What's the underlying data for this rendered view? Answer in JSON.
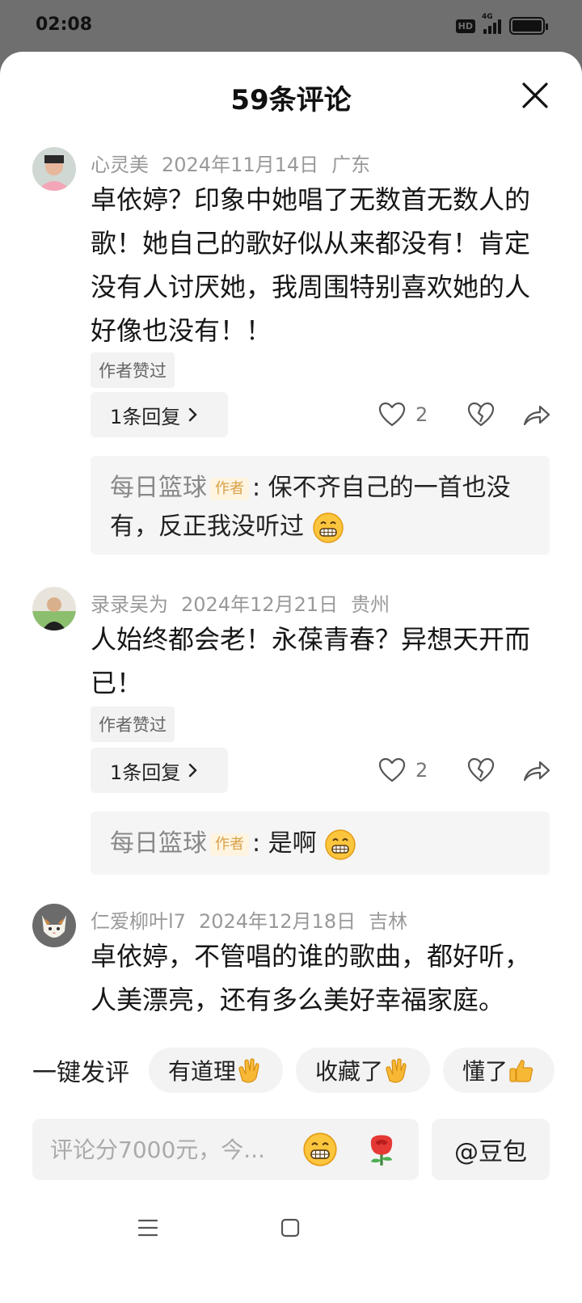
{
  "status": {
    "time": "02:08",
    "hd": "HD",
    "network": "4G"
  },
  "sheet": {
    "title": "59条评论"
  },
  "comments": [
    {
      "author": "心灵美",
      "date": "2024年11月14日",
      "location": "广东",
      "text": "卓依婷？印象中她唱了无数首无数人的歌！她自己的歌好似从来都没有！肯定没有人讨厌她，我周围特别喜欢她的人好像也没有！！",
      "liked_badge": "作者赞过",
      "reply_count_label": "1条回复",
      "like_count": "2",
      "reply": {
        "author": "每日篮球",
        "tag": "作者",
        "text": ": 保不齐自己的一首也没有，反正我没听过"
      }
    },
    {
      "author": "录录吴为",
      "date": "2024年12月21日",
      "location": "贵州",
      "text": "人始终都会老！永葆青春？异想天开而已！",
      "liked_badge": "作者赞过",
      "reply_count_label": "1条回复",
      "like_count": "2",
      "reply": {
        "author": "每日篮球",
        "tag": "作者",
        "text": ": 是啊"
      }
    },
    {
      "author": "仁爱柳叶l7",
      "date": "2024年12月18日",
      "location": "吉林",
      "text": "卓依婷，不管唱的谁的歌曲，都好听，人美漂亮，还有多么美好幸福家庭。"
    }
  ],
  "quick_comments": {
    "label": "一键发评",
    "chips": [
      "有道理",
      "收藏了",
      "懂了"
    ]
  },
  "input": {
    "placeholder": "评论分7000元，今..."
  },
  "doubao": {
    "label": "@豆包"
  },
  "colors": {
    "sheet": "#ffffff",
    "overlay": "#6f6f6f",
    "author_tag": "#d8a14a",
    "meta": "#999999"
  }
}
